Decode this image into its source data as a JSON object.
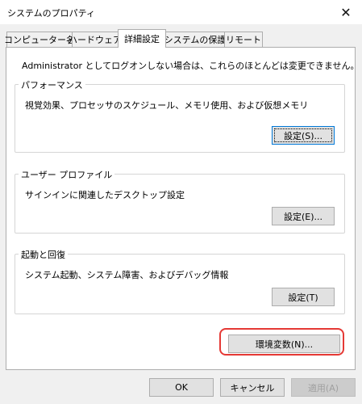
{
  "window": {
    "title": "システムのプロパティ",
    "close_glyph": "✕"
  },
  "tabs": [
    {
      "label": "コンピューター名"
    },
    {
      "label": "ハードウェア"
    },
    {
      "label": "詳細設定",
      "active": true
    },
    {
      "label": "システムの保護"
    },
    {
      "label": "リモート"
    }
  ],
  "admin_note": "Administrator としてログオンしない場合は、これらのほとんどは変更できません。",
  "performance": {
    "title": "パフォーマンス",
    "description": "視覚効果、プロセッサのスケジュール、メモリ使用、および仮想メモリ",
    "button": "設定(S)..."
  },
  "user_profile": {
    "title": "ユーザー プロファイル",
    "description": "サインインに関連したデスクトップ設定",
    "button": "設定(E)..."
  },
  "startup_recovery": {
    "title": "起動と回復",
    "description": "システム起動、システム障害、およびデバッグ情報",
    "button": "設定(T)"
  },
  "env_vars_button": "環境変数(N)...",
  "footer": {
    "ok": "OK",
    "cancel": "キャンセル",
    "apply": "適用(A)"
  },
  "colors": {
    "highlight": "#e53935",
    "focus": "#0078d7"
  }
}
